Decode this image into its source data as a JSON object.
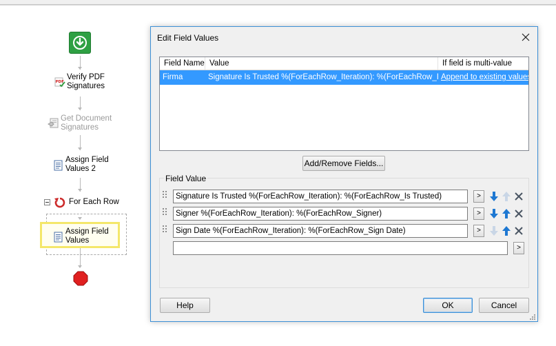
{
  "workflow": {
    "steps": [
      {
        "name": "start",
        "label": ""
      },
      {
        "name": "verify-pdf-signatures",
        "label_line1": "Verify PDF",
        "label_line2": "Signatures",
        "disabled": false
      },
      {
        "name": "get-document-signatures",
        "label_line1": "Get Document",
        "label_line2": "Signatures",
        "disabled": true
      },
      {
        "name": "assign-field-values-2",
        "label_line1": "Assign Field",
        "label_line2": "Values 2",
        "disabled": false
      },
      {
        "name": "for-each-row",
        "label_line1": "For Each Row",
        "disabled": false
      },
      {
        "name": "assign-field-values",
        "label_line1": "Assign Field",
        "label_line2": "Values",
        "disabled": false
      }
    ],
    "colors": {
      "start": "#2ea043",
      "stop": "#e02020",
      "selection": "#f4e76a"
    }
  },
  "dialog": {
    "title": "Edit Field Values",
    "grid": {
      "columns": [
        "Field Name",
        "Value",
        "If field is multi-value"
      ],
      "rows": [
        {
          "field_name": "Firma",
          "value": "Signature Is Trusted %(ForEachRow_Iteration): %(ForEachRow_Is T...",
          "multi": "Append to existing values"
        }
      ]
    },
    "add_remove_label": "Add/Remove Fields...",
    "field_value_group_label": "Field Value",
    "field_values": [
      {
        "value": "Signature Is Trusted %(ForEachRow_Iteration): %(ForEachRow_Is Trusted)",
        "browse": ">",
        "up_enabled": false
      },
      {
        "value": "Signer %(ForEachRow_Iteration): %(ForEachRow_Signer)",
        "browse": ">",
        "up_enabled": true
      },
      {
        "value": "Sign Date %(ForEachRow_Iteration): %(ForEachRow_Sign Date)",
        "browse": ">",
        "up_enabled": true
      }
    ],
    "new_field": {
      "value": "",
      "browse": ">"
    },
    "help_label": "Help",
    "ok_label": "OK",
    "cancel_label": "Cancel"
  },
  "icons": [
    "download-arrow-icon",
    "pdf-signature-icon",
    "document-signature-icon",
    "document-icon",
    "loop-icon",
    "collapse-icon",
    "stop-icon",
    "close-icon",
    "arrow-down-icon",
    "arrow-up-icon",
    "remove-icon",
    "grip-icon"
  ]
}
